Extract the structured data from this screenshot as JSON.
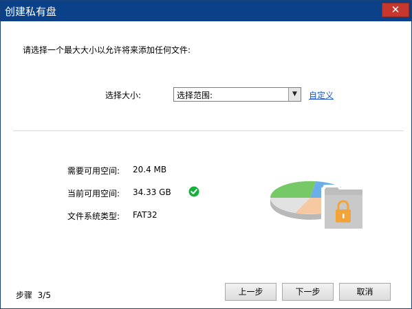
{
  "window": {
    "title": "创建私有盘",
    "close_glyph": "✕"
  },
  "prompt": "请选择一个最大大小以允许将来添加任何文件:",
  "size": {
    "label": "选择大小:",
    "selected": "选择范围:",
    "custom_link": "自定义"
  },
  "info": {
    "required_label": "需要可用空间:",
    "required_value": "20.4 MB",
    "current_label": "当前可用空间:",
    "current_value": "34.33 GB",
    "fs_label": "文件系统类型:",
    "fs_value": "FAT32"
  },
  "icons": {
    "ok": "check-circle-icon",
    "pie": "pie-chart-lock-folder-icon",
    "close": "close-icon",
    "dropdown": "chevron-down-icon"
  },
  "step": {
    "label": "步骤",
    "value": "3/5"
  },
  "buttons": {
    "prev": "上一步",
    "next": "下一步",
    "cancel": "取消"
  },
  "colors": {
    "titlebar": "#0b4189",
    "close": "#c7372d",
    "link": "#1a55c9",
    "ok_green": "#16b13d",
    "pie_blue": "#6aaeea",
    "pie_green": "#77c866",
    "pie_peach": "#f7c9a2",
    "lock_orange": "#f2a33a"
  }
}
